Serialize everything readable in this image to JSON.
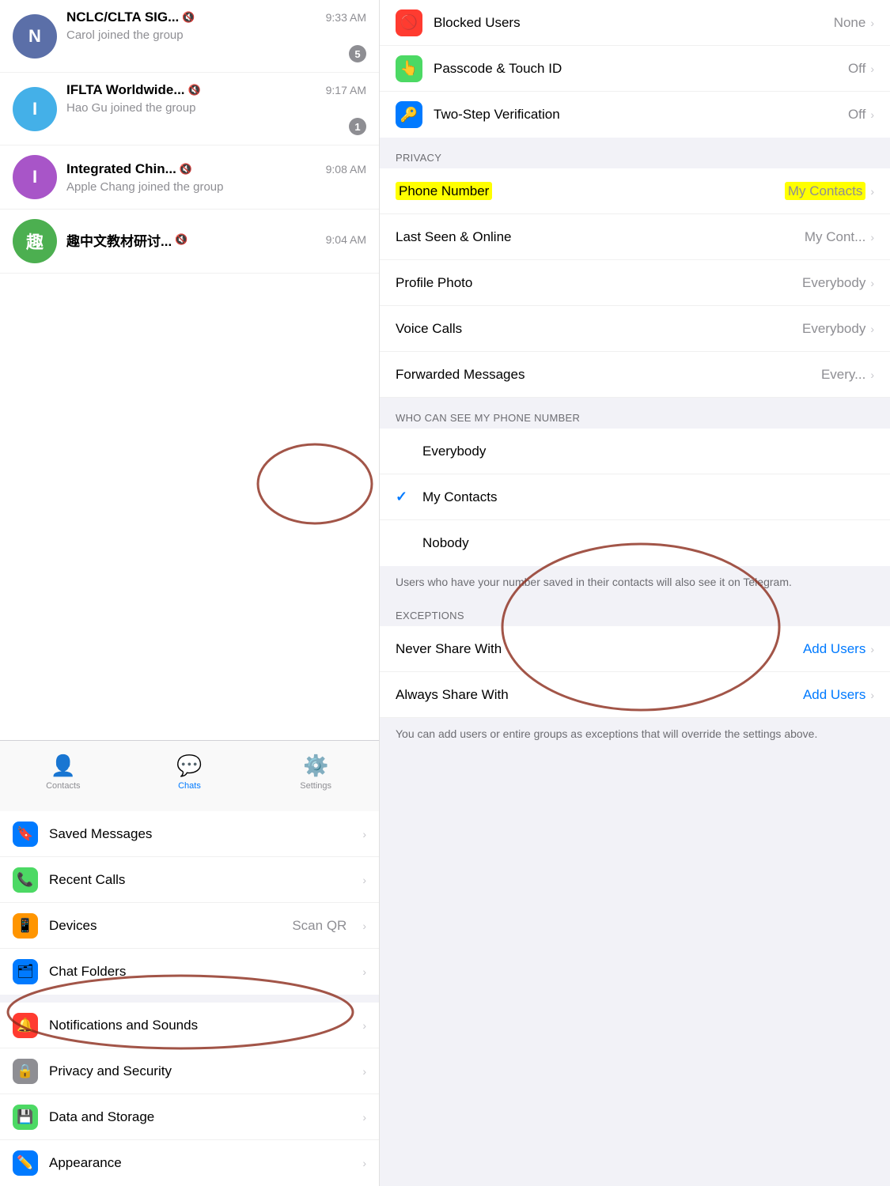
{
  "left": {
    "chats": [
      {
        "id": "nclc",
        "initials": "N",
        "color": "#5b6fa8",
        "name": "NCLC/CLTA SIG...",
        "muted": true,
        "time": "9:33 AM",
        "preview": "Carol joined the group",
        "badge": "5"
      },
      {
        "id": "iflta",
        "initials": "I",
        "color": "#44b0e8",
        "name": "IFLTA Worldwide...",
        "muted": true,
        "time": "9:17 AM",
        "preview": "Hao Gu joined the group",
        "badge": "1"
      },
      {
        "id": "integrated",
        "initials": "I",
        "color": "#a855c8",
        "name": "Integrated Chin...",
        "muted": true,
        "time": "9:08 AM",
        "preview": "Apple Chang joined the group",
        "badge": ""
      },
      {
        "id": "zhongwen",
        "initials": "趣",
        "color": "#4caf50",
        "name": "趣中文教材研讨...",
        "muted": true,
        "time": "9:04 AM",
        "preview": "",
        "badge": ""
      }
    ],
    "tabs": [
      {
        "id": "contacts",
        "label": "Contacts",
        "icon": "👤",
        "active": false
      },
      {
        "id": "chats",
        "label": "Chats",
        "icon": "💬",
        "active": true
      },
      {
        "id": "settings",
        "label": "Settings",
        "icon": "⚙️",
        "active": false
      }
    ],
    "settings": [
      {
        "id": "saved-messages",
        "icon": "🔖",
        "iconBg": "#007aff",
        "label": "Saved Messages",
        "value": "",
        "chevron": true
      },
      {
        "id": "recent-calls",
        "icon": "📞",
        "iconBg": "#4cd964",
        "label": "Recent Calls",
        "value": "",
        "chevron": true
      },
      {
        "id": "devices",
        "icon": "📱",
        "iconBg": "#ff9500",
        "label": "Devices",
        "value": "Scan QR",
        "chevron": true
      },
      {
        "id": "chat-folders",
        "icon": "🗂",
        "iconBg": "#007aff",
        "label": "Chat Folders",
        "value": "",
        "chevron": true
      }
    ],
    "settings2": [
      {
        "id": "notifications",
        "icon": "🔔",
        "iconBg": "#ff3b30",
        "label": "Notifications and Sounds",
        "value": "",
        "chevron": true
      },
      {
        "id": "privacy",
        "icon": "🔒",
        "iconBg": "#8e8e93",
        "label": "Privacy and Security",
        "value": "",
        "chevron": true
      },
      {
        "id": "data-storage",
        "icon": "💾",
        "iconBg": "#4cd964",
        "label": "Data and Storage",
        "value": "",
        "chevron": true
      },
      {
        "id": "appearance",
        "icon": "✏️",
        "iconBg": "#007aff",
        "label": "Appearance",
        "value": "",
        "chevron": true
      }
    ]
  },
  "right": {
    "security_items": [
      {
        "id": "blocked-users",
        "icon": "🚫",
        "iconBg": "#ff3b30",
        "label": "Blocked Users",
        "value": "None",
        "chevron": true
      },
      {
        "id": "passcode",
        "icon": "👆",
        "iconBg": "#4cd964",
        "label": "Passcode & Touch ID",
        "value": "Off",
        "chevron": true
      },
      {
        "id": "two-step",
        "icon": "🔑",
        "iconBg": "#007aff",
        "label": "Two-Step Verification",
        "value": "Off",
        "chevron": true
      }
    ],
    "privacy_header": "PRIVACY",
    "privacy_items": [
      {
        "id": "phone-number",
        "label": "Phone Number",
        "value": "My Contacts",
        "highlighted": true,
        "chevron": true
      },
      {
        "id": "last-seen",
        "label": "Last Seen & Online",
        "value": "My Cont...",
        "highlighted": false,
        "chevron": true
      },
      {
        "id": "profile-photo",
        "label": "Profile Photo",
        "value": "Everybody",
        "highlighted": false,
        "chevron": true
      },
      {
        "id": "voice-calls",
        "label": "Voice Calls",
        "value": "Everybody",
        "highlighted": false,
        "chevron": true
      },
      {
        "id": "forwarded-messages",
        "label": "Forwarded Messages",
        "value": "Every...",
        "highlighted": false,
        "chevron": true
      }
    ],
    "who_can_header": "WHO CAN SEE MY PHONE NUMBER",
    "who_can_items": [
      {
        "id": "everybody",
        "label": "Everybody",
        "checked": false
      },
      {
        "id": "my-contacts",
        "label": "My Contacts",
        "checked": true
      },
      {
        "id": "nobody",
        "label": "Nobody",
        "checked": false
      }
    ],
    "who_can_info": "Users who have your number saved in their contacts will also see it on Telegram.",
    "exceptions_header": "EXCEPTIONS",
    "exceptions_items": [
      {
        "id": "never-share",
        "label": "Never Share With",
        "value": "Add Users",
        "chevron": true
      },
      {
        "id": "always-share",
        "label": "Always Share With",
        "value": "Add Users",
        "chevron": true
      }
    ],
    "exceptions_info": "You can add users or entire groups as exceptions that will override the settings above."
  }
}
